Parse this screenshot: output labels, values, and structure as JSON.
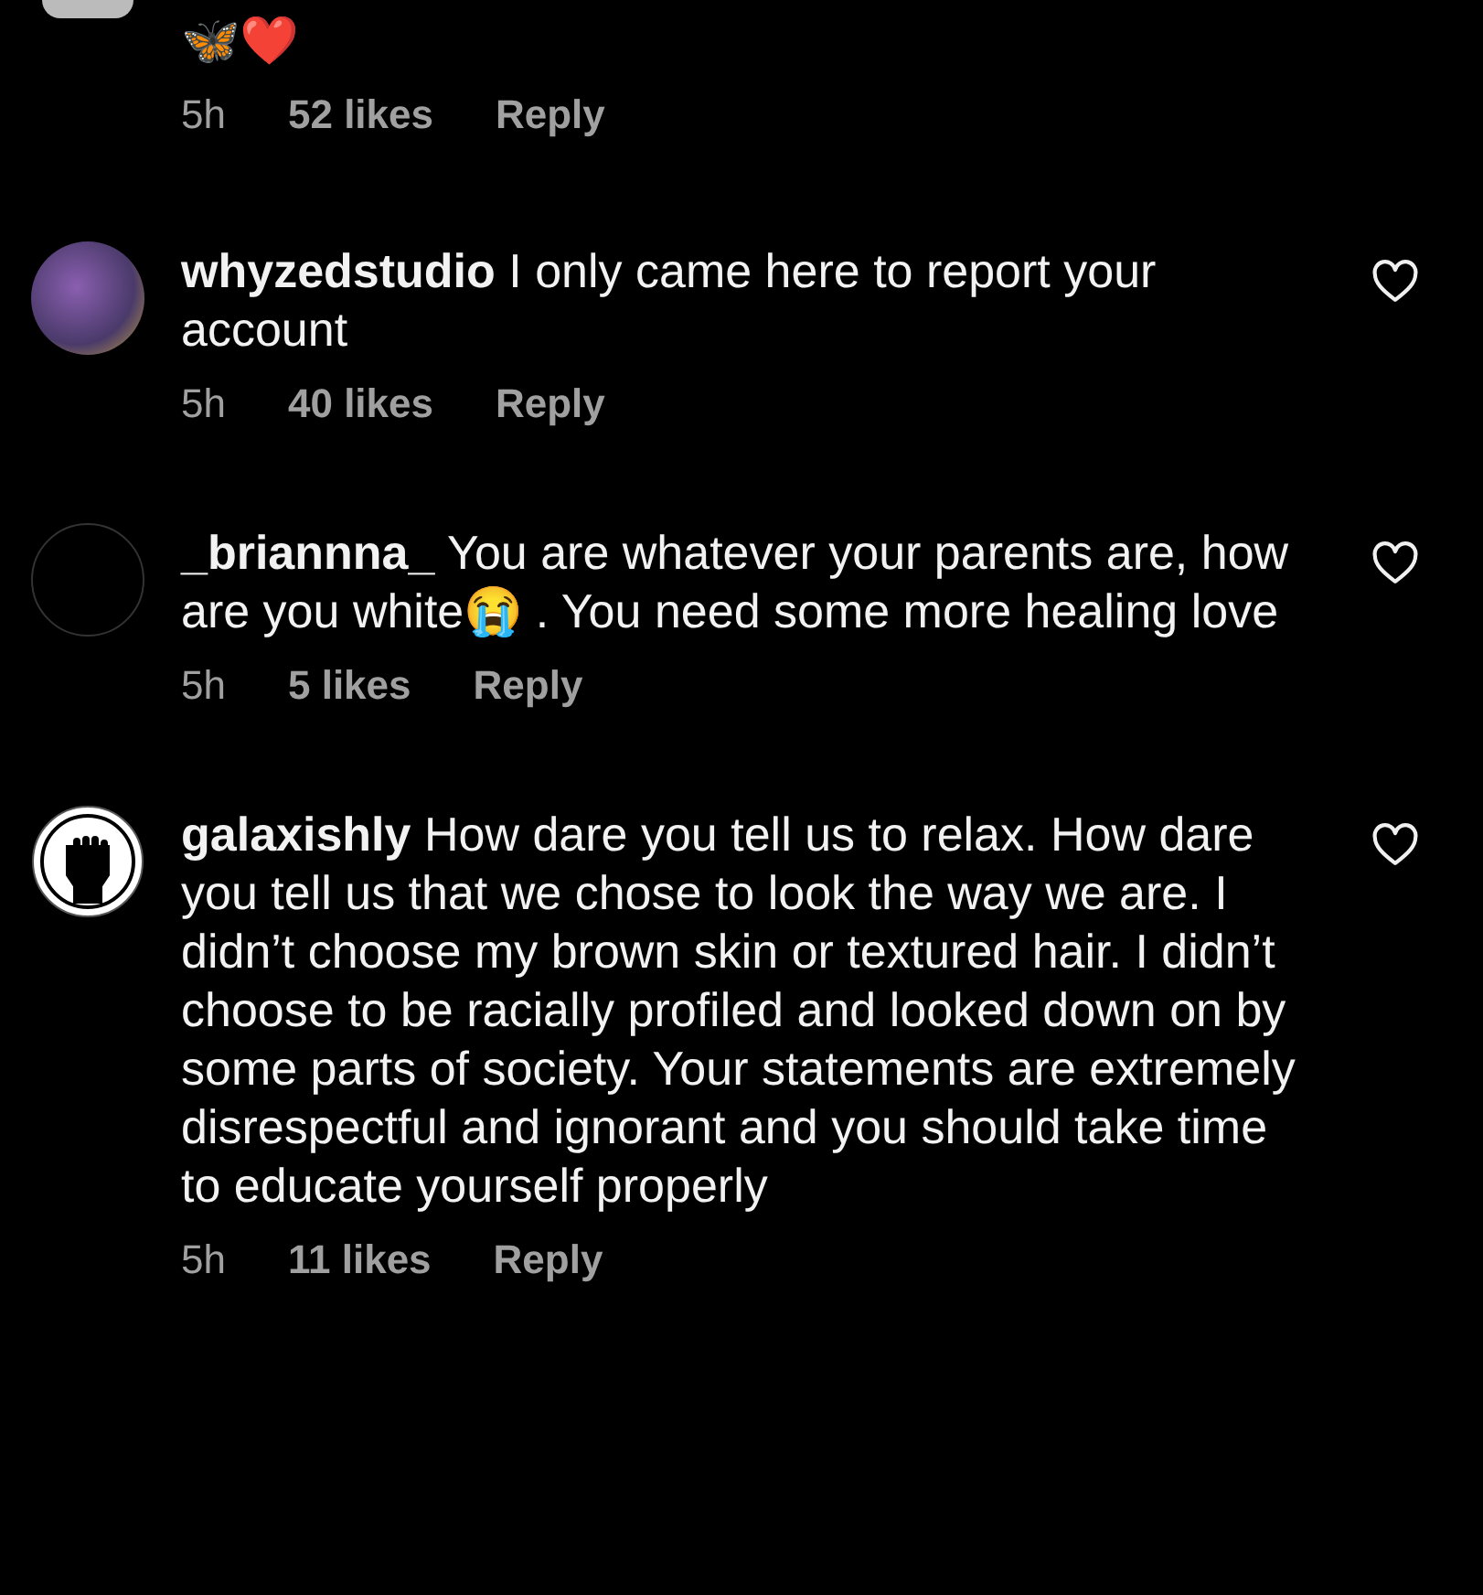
{
  "comments": [
    {
      "kind": "cut",
      "text": "🦋❤️",
      "time": "5h",
      "likes": "52 likes",
      "reply": "Reply"
    },
    {
      "kind": "photo",
      "username": "whyzedstudio",
      "text": "I only came here to report your account",
      "time": "5h",
      "likes": "40 likes",
      "reply": "Reply"
    },
    {
      "kind": "empty",
      "username": "_briannna_",
      "text": "You are whatever your parents are, how are you white😭 . You need some more healing love",
      "time": "5h",
      "likes": "5 likes",
      "reply": "Reply"
    },
    {
      "kind": "fist",
      "username": "galaxishly",
      "text": "How dare you tell us to relax. How dare you tell us that we chose to look the way we are. I didn’t choose my brown skin or textured hair. I didn’t choose to be racially profiled and looked down on by some parts of society. Your statements are extremely disrespectful and ignorant and you should take time to educate yourself properly",
      "time": "5h",
      "likes": "11 likes",
      "reply": "Reply"
    }
  ]
}
